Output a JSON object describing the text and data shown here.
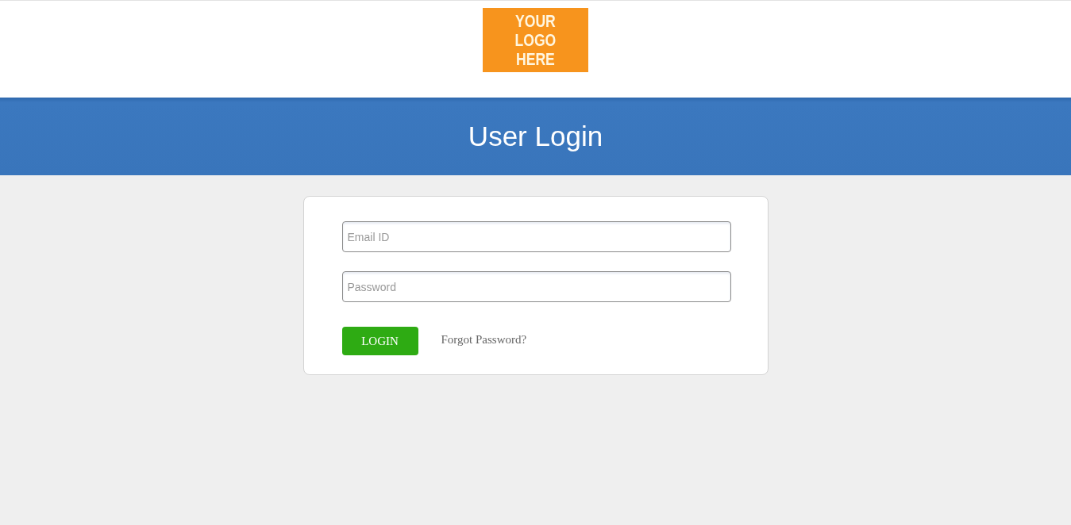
{
  "logo": {
    "text": "YOUR LOGO HERE"
  },
  "banner": {
    "title": "User Login"
  },
  "login_form": {
    "fields": [
      {
        "placeholder": "Email ID"
      },
      {
        "placeholder": "Password"
      }
    ],
    "login_button": "LOGIN",
    "forgot_link": "Forgot Password?"
  }
}
